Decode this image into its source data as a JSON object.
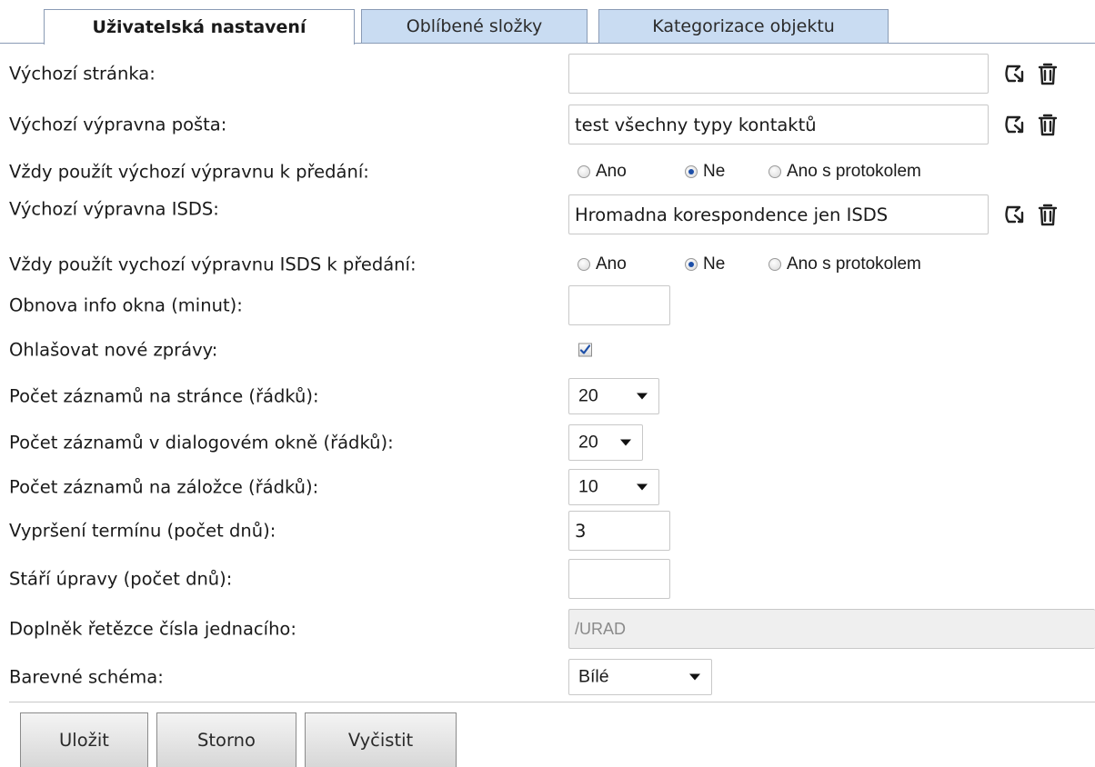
{
  "tabs": [
    {
      "label": "Uživatelská nastavení",
      "active": true
    },
    {
      "label": "Oblíbené složky",
      "active": false
    },
    {
      "label": "Kategorizace objektu",
      "active": false
    }
  ],
  "form": {
    "default_page": {
      "label": "Výchozí stránka:",
      "value": ""
    },
    "default_dispatch": {
      "label": "Výchozí výpravna pošta:",
      "value": "test všechny typy kontaktů"
    },
    "always_use_dispatch": {
      "label": "Vždy použít výchozí výpravnu k předání:",
      "options": [
        "Ano",
        "Ne",
        "Ano s protokolem"
      ],
      "selected": "Ne"
    },
    "default_isds": {
      "label": "Výchozí výpravna ISDS:",
      "value": "Hromadna korespondence jen ISDS"
    },
    "always_use_isds": {
      "label": "Vždy použít vychozí výpravnu ISDS k předání:",
      "options": [
        "Ano",
        "Ne",
        "Ano s protokolem"
      ],
      "selected": "Ne"
    },
    "info_refresh": {
      "label": "Obnova info okna (minut):",
      "value": ""
    },
    "announce_messages": {
      "label": "Ohlašovat nové zprávy:",
      "checked": true
    },
    "rows_per_page": {
      "label": "Počet záznamů na stránce (řádků):",
      "value": "20"
    },
    "rows_per_dialog": {
      "label": "Počet záznamů v dialogovém okně (řádků):",
      "value": "20"
    },
    "rows_per_tab": {
      "label": "Počet záznamů na záložce (řádků):",
      "value": "10"
    },
    "deadline_expiry": {
      "label": "Vypršení termínu (počet dnů):",
      "value": "3"
    },
    "edit_age": {
      "label": "Stáří úpravy (počet dnů):",
      "value": ""
    },
    "ref_number_suffix": {
      "label": "Doplněk řetězce čísla jednacího:",
      "value": "/URAD"
    },
    "color_scheme": {
      "label": "Barevné schéma:",
      "value": "Bílé"
    }
  },
  "buttons": {
    "save": "Uložit",
    "cancel": "Storno",
    "clear": "Vyčistit"
  },
  "icons": {
    "select": "select-arrow-icon",
    "delete": "trash-icon"
  },
  "colors": {
    "tab_inactive_bg": "#c9dcf2",
    "tab_border": "#8a9bb5",
    "radio_dot": "#1d4fa8"
  }
}
